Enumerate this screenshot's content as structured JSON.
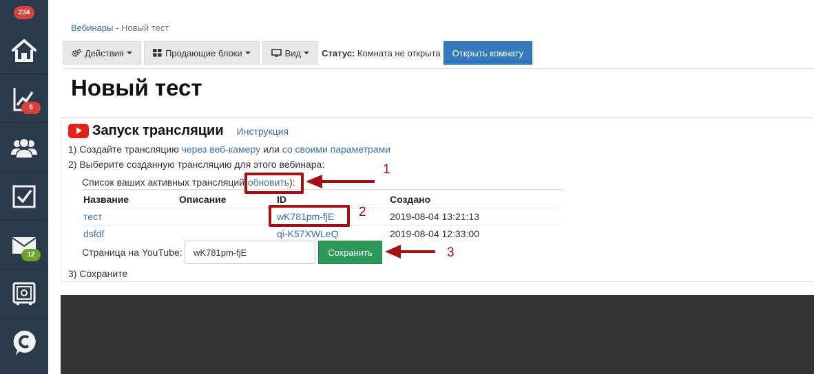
{
  "sidebar": {
    "top_badge": "234",
    "items": [
      {
        "icon": "home-icon"
      },
      {
        "icon": "chart-icon",
        "badge": "6",
        "badge_color": "#d9403a"
      },
      {
        "icon": "users-icon"
      },
      {
        "icon": "checkbox-icon"
      },
      {
        "icon": "mail-icon",
        "badge": "12",
        "badge_color": "#6aa329"
      },
      {
        "icon": "safe-icon"
      },
      {
        "icon": "chat-icon"
      }
    ],
    "background": "#2b3a4a"
  },
  "breadcrumb": {
    "parent": "Вебинары",
    "separator": "-",
    "current": "Новый тест"
  },
  "toolbar": {
    "actions_label": "Действия",
    "blocks_label": "Продающие блоки",
    "view_label": "Вид",
    "status_label": "Статус:",
    "status_value": "Комната не открыта",
    "open_room_label": "Открыть комнату"
  },
  "page_title": "Новый тест",
  "broadcast": {
    "title": "Запуск трансляции",
    "instruction_link": "Инструкция",
    "step1_prefix": "1) Создайте трансляцию",
    "step1_link1": "через веб-камеру",
    "step1_mid": "или",
    "step1_link2": "со своими параметрами",
    "step2": "2) Выберите созданную трансляцию для этого вебинара:",
    "list_label": "Список ваших активных трансляций",
    "refresh_open": "(",
    "refresh_link": "обновить",
    "refresh_close": "):",
    "columns": [
      "Название",
      "Описание",
      "ID",
      "Создано"
    ],
    "rows": [
      {
        "name": "тест",
        "description": "",
        "id": "wK781pm-fjE",
        "created": "2019-08-04 13:21:13"
      },
      {
        "name": "dsfdf",
        "description": "",
        "id": "qi-K57XWLeQ",
        "created": "2019-08-04 12:33:00"
      }
    ],
    "youtube_page_label": "Страница на YouTube:",
    "youtube_page_value": "wK781pm-fjE",
    "save_label": "Сохранить",
    "step3": "3) Сохраните"
  },
  "annotations": [
    "1",
    "2",
    "3"
  ],
  "colors": {
    "link": "#3a6fa5",
    "primary": "#3379be",
    "success": "#2d9a5a",
    "annotation": "#a31115",
    "youtube": "#e62117"
  }
}
